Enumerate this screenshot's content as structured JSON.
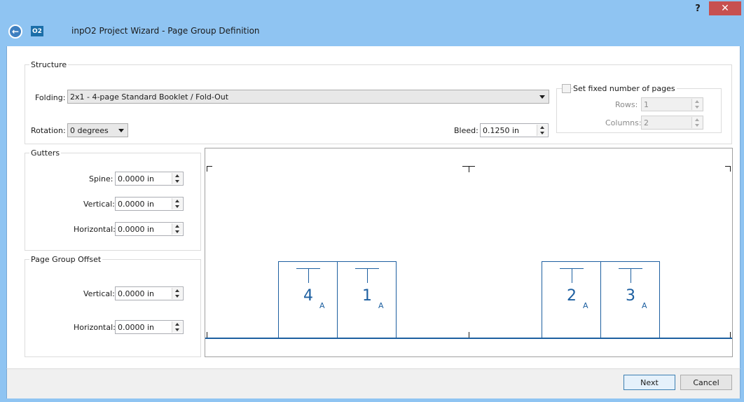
{
  "titlebar": {
    "help_label": "?",
    "close_label": "✕",
    "back_label": "←",
    "logo": "O2",
    "title": "inpO2 Project Wizard - Page Group Definition"
  },
  "structure": {
    "legend": "Structure",
    "folding_label": "Folding:",
    "folding_value": "2x1 - 4-page Standard Booklet / Fold-Out",
    "rotation_label": "Rotation:",
    "rotation_value": "0 degrees",
    "bleed_label": "Bleed:",
    "bleed_value": "0.1250 in",
    "fixed_pages_label": "Set fixed number of pages",
    "fixed_pages_checked": false,
    "rows_label": "Rows:",
    "rows_value": "1",
    "columns_label": "Columns:",
    "columns_value": "2"
  },
  "gutters": {
    "legend": "Gutters",
    "spine_label": "Spine:",
    "spine_value": "0.0000 in",
    "vertical_label": "Vertical:",
    "vertical_value": "0.0000 in",
    "horizontal_label": "Horizontal:",
    "horizontal_value": "0.0000 in"
  },
  "offset": {
    "legend": "Page Group Offset",
    "vertical_label": "Vertical:",
    "vertical_value": "0.0000 in",
    "horizontal_label": "Horizontal:",
    "horizontal_value": "0.0000 in"
  },
  "preview": {
    "pages": [
      {
        "number": "4",
        "side": "A"
      },
      {
        "number": "1",
        "side": "A"
      },
      {
        "number": "2",
        "side": "A"
      },
      {
        "number": "3",
        "side": "A"
      }
    ],
    "accent_color": "#1d5fa0"
  },
  "footer": {
    "next_label": "Next",
    "cancel_label": "Cancel"
  }
}
